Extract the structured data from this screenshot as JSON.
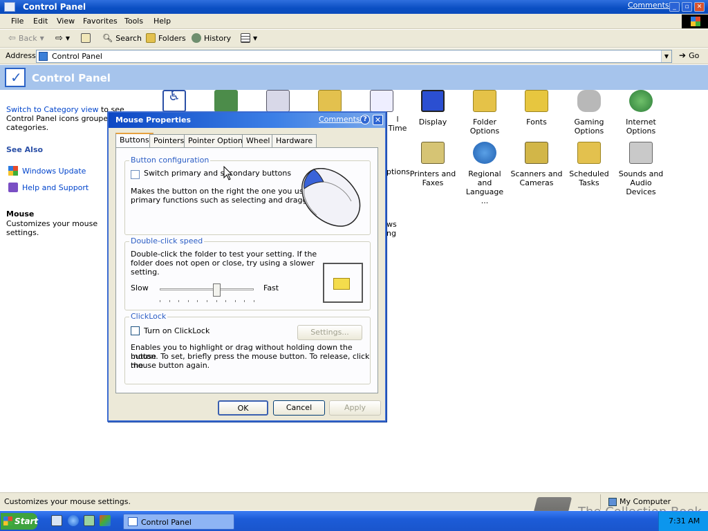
{
  "window": {
    "title": "Control Panel",
    "comments_link": "Comments?"
  },
  "menu": [
    "File",
    "Edit",
    "View",
    "Favorites",
    "Tools",
    "Help"
  ],
  "toolbar": {
    "back": "Back",
    "search": "Search",
    "folders": "Folders",
    "history": "History"
  },
  "address": {
    "label": "Address",
    "value": "Control Panel",
    "go": "Go"
  },
  "header": {
    "title": "Control Panel"
  },
  "left_pane": {
    "switch_link": "Switch to Category view",
    "switch_rest_1": "to see",
    "switch_rest_2": "Control Panel icons grouped in",
    "switch_rest_3": "categories.",
    "see_also": "See Also",
    "windows_update": "Windows Update",
    "help_support": "Help and Support",
    "selected_title": "Mouse",
    "selected_desc": "Customizes your mouse settings."
  },
  "icons": [
    {
      "label": "Display",
      "icon": "display-icon",
      "color": "#2b4fd1"
    },
    {
      "label": "Folder Options",
      "icon": "folder-options-icon",
      "color": "#e5c248"
    },
    {
      "label": "Fonts",
      "icon": "fonts-icon",
      "color": "#e7c63f"
    },
    {
      "label": "Gaming Options",
      "icon": "game-controller-icon",
      "color": "#8e8e8e"
    },
    {
      "label": "Internet Options",
      "icon": "globe-icon",
      "color": "#3c8f3a"
    },
    {
      "label": "Printers and Faxes",
      "icon": "printer-icon",
      "color": "#d6c474"
    },
    {
      "label": "Regional and Language ...",
      "icon": "globe-icon",
      "color": "#2e7fd3"
    },
    {
      "label": "Scanners and Cameras",
      "icon": "scanner-icon",
      "color": "#d2b648"
    },
    {
      "label": "Scheduled Tasks",
      "icon": "scheduled-tasks-icon",
      "color": "#e3c14e"
    },
    {
      "label": "Sounds and Audio Devices",
      "icon": "speaker-icon",
      "color": "#c9c9c9"
    }
  ],
  "partial_labels": {
    "time": "l Time",
    "options": "ptions",
    "ws": "ws",
    "ng": "ng"
  },
  "dialog": {
    "title": "Mouse Properties",
    "comments": "Comments?",
    "help": "?",
    "tabs": [
      "Buttons",
      "Pointers",
      "Pointer Options",
      "Wheel",
      "Hardware"
    ],
    "active_tab": "Buttons",
    "button_config": {
      "title": "Button configuration",
      "checkbox": "Switch primary and secondary buttons",
      "checked": false,
      "desc_1": "Makes the button on the right the one you use for",
      "desc_2": "primary functions such as selecting and dragging."
    },
    "double_click": {
      "title": "Double-click speed",
      "desc_1": "Double-click the folder to test your setting. If the",
      "desc_2": "folder does not open or close, try using a slower",
      "desc_3": "setting.",
      "slow": "Slow",
      "fast": "Fast",
      "speed": 0.6
    },
    "clicklock": {
      "title": "ClickLock",
      "checkbox": "Turn on ClickLock",
      "checked": false,
      "settings": "Settings...",
      "desc_1": "Enables you to highlight or drag without holding down the mouse",
      "desc_2": "button. To set, briefly press the mouse button. To release, click the",
      "desc_3": "mouse button again."
    },
    "ok": "OK",
    "cancel": "Cancel",
    "apply": "Apply"
  },
  "status": {
    "text": "Customizes your mouse settings.",
    "zone": "My Computer"
  },
  "taskbar": {
    "start": "Start",
    "task": "Control Panel",
    "clock": "7:31 AM"
  },
  "watermark": "The Collection Book"
}
